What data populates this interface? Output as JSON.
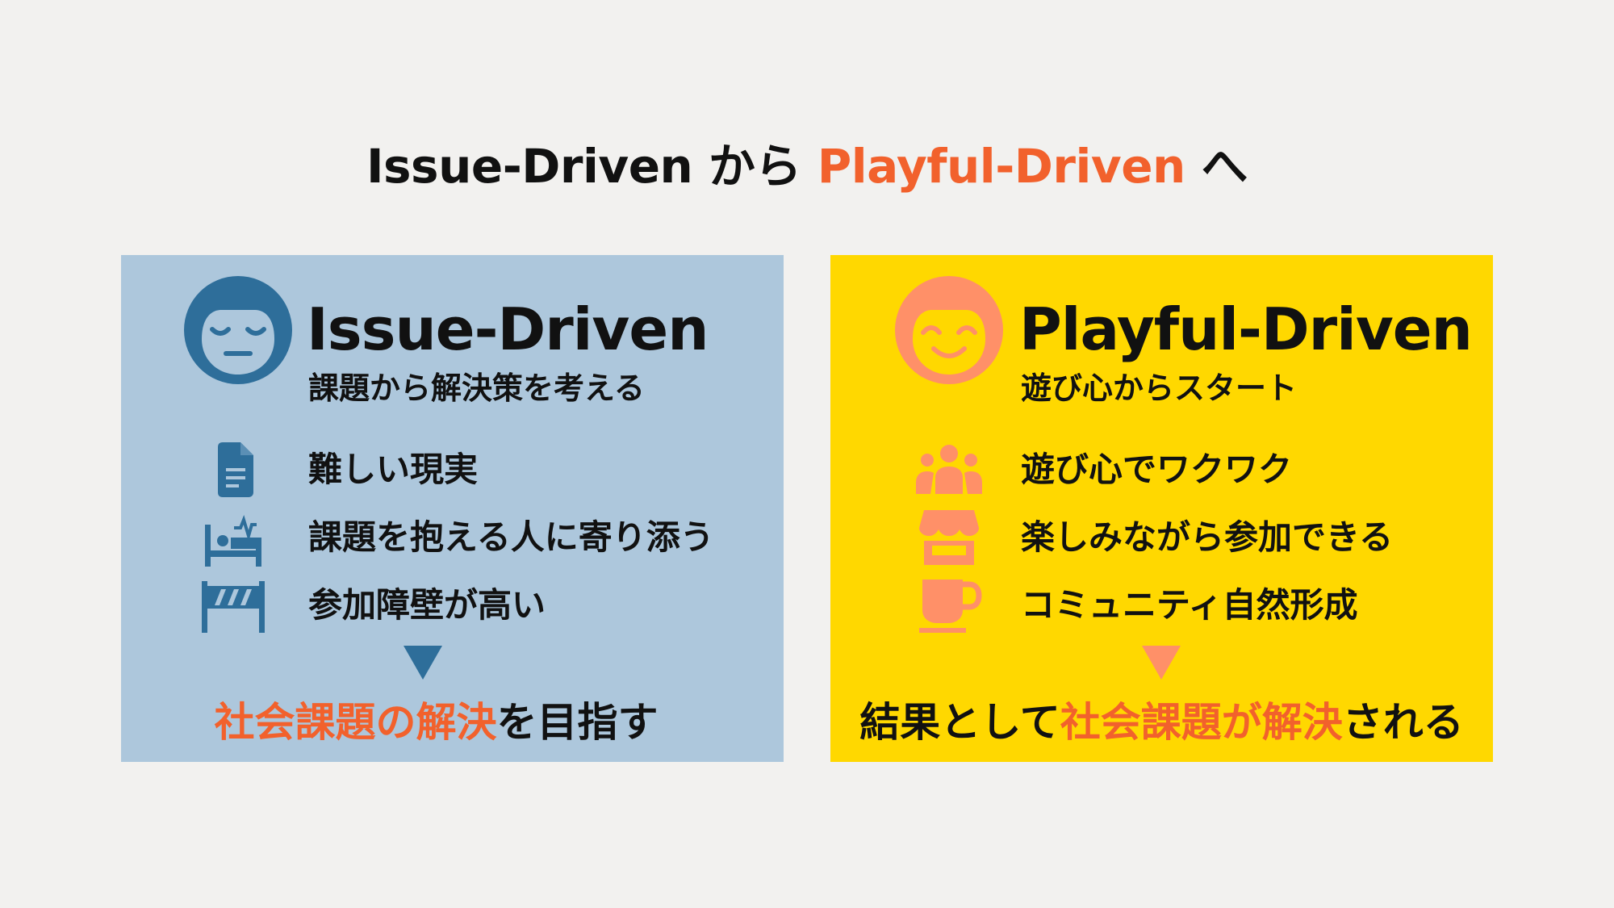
{
  "title": {
    "part1": "Issue-Driven から ",
    "accent": "Playful-Driven",
    "part2": " へ"
  },
  "colors": {
    "background": "#f2f1ef",
    "accent_orange": "#f2612c",
    "issue_panel": "#adc7dc",
    "issue_icon": "#2e6e9a",
    "playful_panel": "#ffd800",
    "playful_icon": "#ff9068",
    "text": "#111111"
  },
  "issue": {
    "heading": "Issue-Driven",
    "subheading": "課題から解決策を考える",
    "face_icon": "sleepy-face-icon",
    "items": [
      {
        "icon": "document-icon",
        "label": "難しい現実"
      },
      {
        "icon": "sick-bed-icon",
        "label": "課題を抱える人に寄り添う"
      },
      {
        "icon": "barrier-icon",
        "label": "参加障壁が高い"
      }
    ],
    "conclusion": {
      "accent1": "社会課題",
      "plain1": "の",
      "accent2": "解決",
      "plain2": "を目指す"
    }
  },
  "playful": {
    "heading": "Playful-Driven",
    "subheading": "遊び心からスタート",
    "face_icon": "smiling-face-icon",
    "items": [
      {
        "icon": "group-icon",
        "label": "遊び心でワクワク"
      },
      {
        "icon": "storefront-icon",
        "label": "楽しみながら参加できる"
      },
      {
        "icon": "coffee-cup-icon",
        "label": "コミュニティ自然形成"
      }
    ],
    "conclusion": {
      "plain1": "結果として",
      "accent1": "社会課題",
      "accent_mid": "が",
      "accent2": "解決",
      "plain2": "される"
    }
  }
}
